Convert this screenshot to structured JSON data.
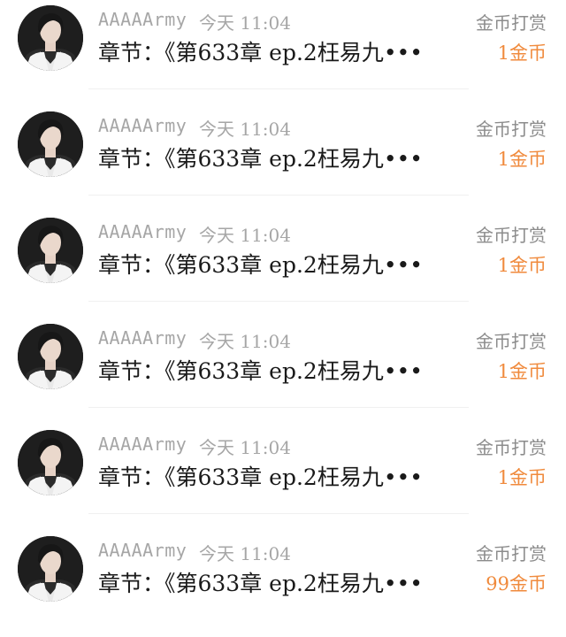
{
  "accent_color": "#f08a3c",
  "reward_label": "金币打赏",
  "items": [
    {
      "username": "AAAAArmy",
      "time": "今天 11:04",
      "chapter": "章节：《第633章 ep.2枉易九•••",
      "reward_amount": "1金币",
      "avatar_icon": "user-avatar-icon"
    },
    {
      "username": "AAAAArmy",
      "time": "今天 11:04",
      "chapter": "章节：《第633章 ep.2枉易九•••",
      "reward_amount": "1金币",
      "avatar_icon": "user-avatar-icon"
    },
    {
      "username": "AAAAArmy",
      "time": "今天 11:04",
      "chapter": "章节：《第633章 ep.2枉易九•••",
      "reward_amount": "1金币",
      "avatar_icon": "user-avatar-icon"
    },
    {
      "username": "AAAAArmy",
      "time": "今天 11:04",
      "chapter": "章节：《第633章 ep.2枉易九•••",
      "reward_amount": "1金币",
      "avatar_icon": "user-avatar-icon"
    },
    {
      "username": "AAAAArmy",
      "time": "今天 11:04",
      "chapter": "章节：《第633章 ep.2枉易九•••",
      "reward_amount": "1金币",
      "avatar_icon": "user-avatar-icon"
    },
    {
      "username": "AAAAArmy",
      "time": "今天 11:04",
      "chapter": "章节：《第633章 ep.2枉易九•••",
      "reward_amount": "99金币",
      "avatar_icon": "user-avatar-icon"
    }
  ]
}
